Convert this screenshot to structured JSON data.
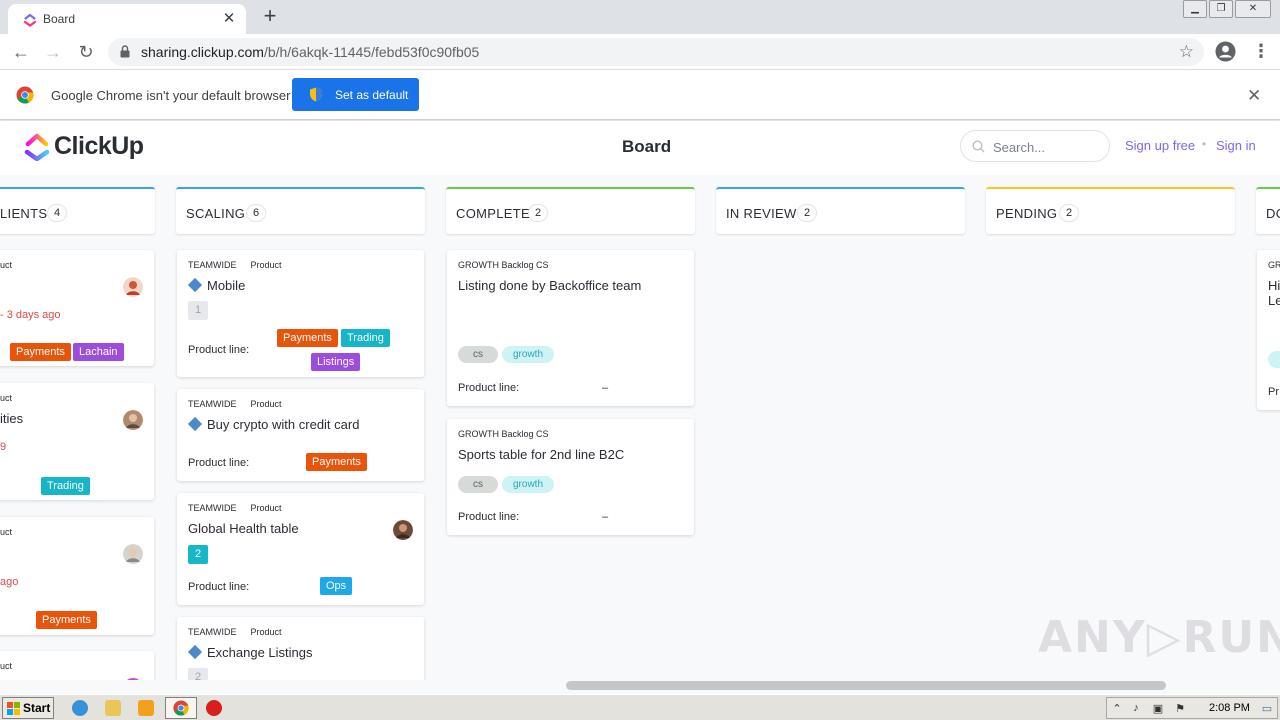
{
  "browser": {
    "tab_title": "Board",
    "url_host": "sharing.clickup.com",
    "url_path": "/b/h/6akqk-11445/febd53f0c90fb05",
    "infobar_text": "Google Chrome isn't your default browser",
    "infobar_button": "Set as default"
  },
  "header": {
    "logo_text": "ClickUp",
    "title": "Board",
    "search_placeholder": "Search...",
    "sign_up": "Sign up free",
    "separator": "•",
    "sign_in": "Sign in"
  },
  "columns": [
    {
      "name": "LIENTS",
      "count": "4",
      "color": "#3ea3d8"
    },
    {
      "name": "SCALING",
      "count": "6",
      "color": "#3ea3d8"
    },
    {
      "name": "COMPLETE",
      "count": "2",
      "color": "#6bc950"
    },
    {
      "name": "IN REVIEW",
      "count": "2",
      "color": "#3ea3d8"
    },
    {
      "name": "PENDING",
      "count": "2",
      "color": "#f8c61c"
    },
    {
      "name": "DO",
      "color": "#6bc950"
    }
  ],
  "product_line_label": "Product line:",
  "clients_cards": [
    {
      "crumb": "uct",
      "due": "- 3 days ago",
      "tags": [
        "Payments",
        "Lachain"
      ]
    },
    {
      "crumb": "uct",
      "title": "ities",
      "due": "9",
      "tags": [
        "Trading"
      ]
    },
    {
      "crumb": "uct",
      "due": "ago",
      "tags": [
        "Payments"
      ]
    },
    {
      "crumb": "uct"
    }
  ],
  "scaling_cards": [
    {
      "space": "TEAMWIDE",
      "list": "Product",
      "title": "Mobile",
      "subtasks": "1",
      "tags": [
        "Payments",
        "Trading",
        "Listings"
      ]
    },
    {
      "space": "TEAMWIDE",
      "list": "Product",
      "title": "Buy crypto with credit card",
      "tags": [
        "Payments"
      ]
    },
    {
      "space": "TEAMWIDE",
      "list": "Product",
      "title": "Global Health table",
      "subtasks": "2",
      "tags": [
        "Ops"
      ]
    },
    {
      "space": "TEAMWIDE",
      "list": "Product",
      "title": "Exchange Listings",
      "subtasks": "2"
    }
  ],
  "complete_cards": [
    {
      "crumb": "GROWTH Backlog CS",
      "title": "Listing done by Backoffice team",
      "chips": [
        "cs",
        "growth"
      ],
      "product_line": "–"
    },
    {
      "crumb": "GROWTH Backlog CS",
      "title": "Sports table for 2nd line B2C",
      "chips": [
        "cs",
        "growth"
      ],
      "product_line": "–"
    }
  ],
  "do_card": {
    "crumb": "GR",
    "title_1": "Hi",
    "title_2": "Le",
    "chip": "g",
    "pl": "Pr"
  },
  "watermark": "ANY▷RUN",
  "taskbar": {
    "start": "Start",
    "clock": "2:08 PM"
  }
}
